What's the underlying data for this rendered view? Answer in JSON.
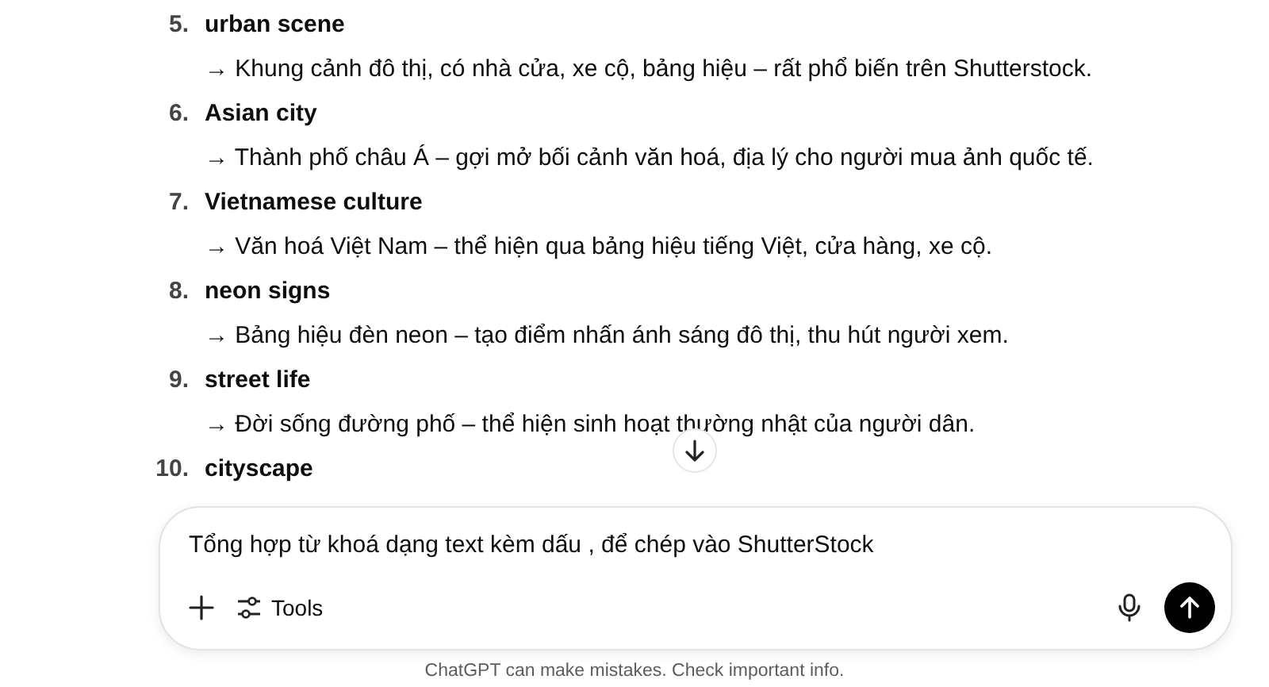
{
  "items": [
    {
      "number": "5.",
      "title": "urban scene",
      "description": "→ Khung cảnh đô thị, có nhà cửa, xe cộ, bảng hiệu – rất phổ biến trên Shutterstock."
    },
    {
      "number": "6.",
      "title": "Asian city",
      "description": "→ Thành phố châu Á – gợi mở bối cảnh văn hoá, địa lý cho người mua ảnh quốc tế."
    },
    {
      "number": "7.",
      "title": "Vietnamese culture",
      "description": "→ Văn hoá Việt Nam – thể hiện qua bảng hiệu tiếng Việt, cửa hàng, xe cộ."
    },
    {
      "number": "8.",
      "title": "neon signs",
      "description": "→ Bảng hiệu đèn neon – tạo điểm nhấn ánh sáng đô thị, thu hút người xem."
    },
    {
      "number": "9.",
      "title": "street life",
      "description": "→ Đời sống đường phố – thể hiện sinh hoạt thường nhật của người dân."
    },
    {
      "number": "10.",
      "title": "cityscape"
    }
  ],
  "composer": {
    "value": "Tổng hợp từ khoá dạng text kèm dấu , để chép vào ShutterStock",
    "tools_label": "Tools"
  },
  "disclaimer": "ChatGPT can make mistakes. Check important info."
}
